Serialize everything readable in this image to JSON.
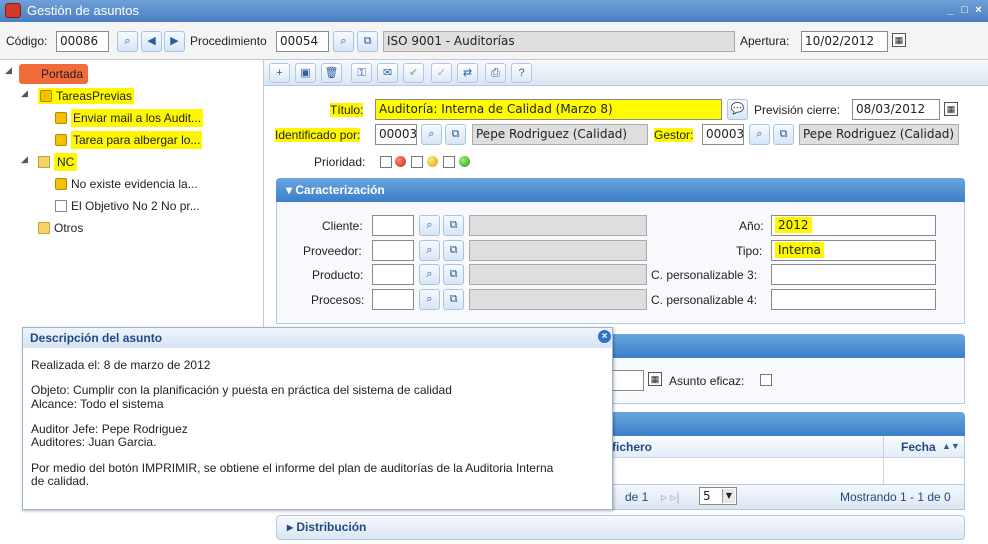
{
  "window": {
    "title": "Gestión de asuntos"
  },
  "topbar": {
    "codigo_label": "Código:",
    "codigo_value": "00086",
    "procedimiento_label": "Procedimiento",
    "procedimiento_code": "00054",
    "procedimiento_name": "ISO 9001 - Auditorías",
    "apertura_label": "Apertura:",
    "apertura_value": "10/02/2012"
  },
  "tree": {
    "root": "Portada",
    "items": [
      {
        "label": "TareasPrevias"
      },
      {
        "label": "Enviar mail a los Audit..."
      },
      {
        "label": "Tarea para albergar lo..."
      },
      {
        "label": "NC"
      },
      {
        "label": "No existe evidencia la..."
      },
      {
        "label": "El Objetivo No 2 No pr..."
      },
      {
        "label": "Otros"
      }
    ]
  },
  "form": {
    "titulo_label": "Título:",
    "titulo_value": "Auditoría: Interna de Calidad  (Marzo 8)",
    "prevision_label": "Previsión cierre:",
    "prevision_value": "08/03/2012",
    "identificado_label": "Identificado por:",
    "identificado_code": "00003",
    "identificado_name": "Pepe Rodriguez (Calidad)",
    "gestor_label": "Gestor:",
    "gestor_code": "00003",
    "gestor_name": "Pepe Rodriguez (Calidad)",
    "prioridad_label": "Prioridad:"
  },
  "caracterizacion": {
    "header": "Caracterización",
    "cliente_label": "Cliente:",
    "proveedor_label": "Proveedor:",
    "producto_label": "Producto:",
    "procesos_label": "Procesos:",
    "anio_label": "Año:",
    "anio_value": "2012",
    "tipo_label": "Tipo:",
    "tipo_value": "Interna",
    "cp3_label": "C. personalizable 3:",
    "cp4_label": "C. personalizable 4:"
  },
  "eficacia": {
    "eficaz_label": "Asunto eficaz:"
  },
  "files": {
    "col_fichero": "fichero",
    "col_fecha": "Fecha",
    "page_of": "de 1",
    "page_size": "5",
    "showing": "Mostrando 1 - 1 de 0"
  },
  "distribucion": {
    "header": "Distribución"
  },
  "popup": {
    "title": "Descripción del asunto",
    "lines": [
      "Realizada el: 8 de marzo de 2012",
      "Objeto: Cumplir con la planificación y puesta en práctica del sistema de calidad",
      "Alcance: Todo el sistema",
      "Auditor Jefe: Pepe Rodriguez",
      "Auditores: Juan Garcia.",
      "Por medio del botón IMPRIMIR, se obtiene el informe del plan de auditorías de la Auditoria Interna",
      "de calidad."
    ]
  },
  "colors": {
    "accent": "#3a7fc9",
    "highlight": "#fffc00",
    "portada": "#f26b3a"
  }
}
